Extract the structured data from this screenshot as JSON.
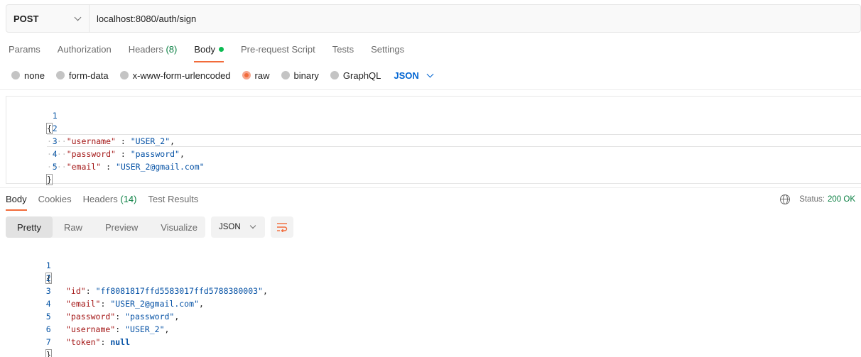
{
  "request": {
    "method": "POST",
    "url": "localhost:8080/auth/sign"
  },
  "request_tabs": {
    "params": "Params",
    "authorization": "Authorization",
    "headers": "Headers",
    "headers_count": "(8)",
    "body": "Body",
    "prerequest": "Pre-request Script",
    "tests": "Tests",
    "settings": "Settings"
  },
  "body_types": {
    "none": "none",
    "form_data": "form-data",
    "urlencoded": "x-www-form-urlencoded",
    "raw": "raw",
    "binary": "binary",
    "graphql": "GraphQL",
    "language": "JSON",
    "selected": "raw"
  },
  "request_body": {
    "line_numbers": [
      "1",
      "2",
      "3",
      "4",
      "5"
    ],
    "open": "{",
    "close": "}",
    "indent": "····",
    "k_username": "\"username\"",
    "v_username": "\"USER_2\"",
    "k_password": "\"password\"",
    "v_password": "\"password\"",
    "k_email": "\"email\"",
    "v_email": "\"USER_2@gmail.com\""
  },
  "response_tabs": {
    "body": "Body",
    "cookies": "Cookies",
    "headers": "Headers",
    "headers_count": "(14)",
    "test_results": "Test Results"
  },
  "status": {
    "label": "Status:",
    "value": "200 OK",
    "value_color": "#0b8043"
  },
  "format_toolbar": {
    "pretty": "Pretty",
    "raw": "Raw",
    "preview": "Preview",
    "visualize": "Visualize",
    "language": "JSON"
  },
  "response_body": {
    "line_numbers": [
      "1",
      "2",
      "3",
      "4",
      "5",
      "6",
      "7"
    ],
    "open": "{",
    "close": "}",
    "k_id": "\"id\"",
    "v_id": "\"ff8081817ffd5583017ffd5788380003\"",
    "k_email": "\"email\"",
    "v_email": "\"USER_2@gmail.com\"",
    "k_password": "\"password\"",
    "v_password": "\"password\"",
    "k_username": "\"username\"",
    "v_username": "\"USER_2\"",
    "k_token": "\"token\"",
    "v_token": "null"
  },
  "colors": {
    "accent": "#f26b3a",
    "link_blue": "#0265d2",
    "count_green": "#0b8043",
    "json_key": "#a31515",
    "json_string": "#0451a5"
  }
}
